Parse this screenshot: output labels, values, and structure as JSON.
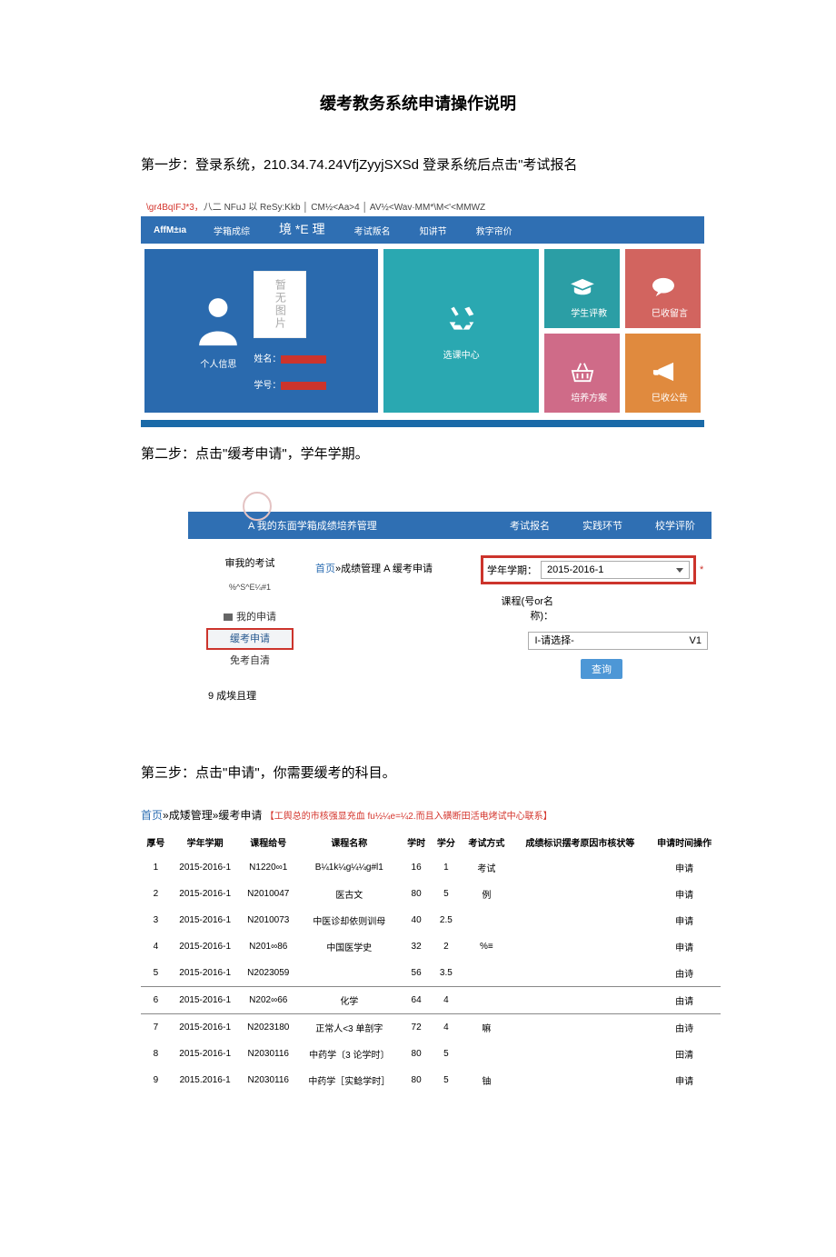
{
  "title": "缓考教务系统申请操作说明",
  "step1": "第一步：登录系统，210.34.74.24VfjZyyjSXSd 登录系统后点击\"考试报名",
  "step2": "第二步：点击\"缓考申请\"，学年学期。",
  "step3": "第三步：点击\"申请\"，你需要缓考的科目。",
  "shot1": {
    "topbar_red": "\\gr4BqIFJ*3，",
    "topbar_rest": "八二 NFuJ 以 ReSy:Kkb │ CM½<Aa>4 │ AV½<Wav·MM*\\M<'<MMWZ",
    "brand": "AffM±ıa",
    "nav": [
      "学箱成综",
      "境 *E 理",
      "考试叛名",
      "知讲节",
      "救字帘价"
    ],
    "tile_person": "个人信思",
    "noimg": "暂无图片",
    "name_lbl": "姓名：",
    "num_lbl": "学号：",
    "tile_course": "选课中心",
    "tile_eval": "学生评教",
    "tile_msg": "巳收留言",
    "tile_plan": "培养方案",
    "tile_notice": "巳收公告"
  },
  "shot2": {
    "navA": "A 我的东面学箱成绩培养管理",
    "nav": [
      "考试报名",
      "实践环节",
      "校学评阶"
    ],
    "side_hdr": "审我的考试",
    "side_sub": "%^S^E¼#1",
    "side_items": [
      "我的申请",
      "缓考申请",
      "免考自清"
    ],
    "side_foot": "9 成埃且理",
    "bread_home": "首页",
    "bread_rest": "»成绩管理 A 缓考申请",
    "f_term_lbl": "学年学期：",
    "f_term_val": "2015-2016-1",
    "f_course_lbl": "课程(号or名称)：",
    "f_course_ph": "I-请选择-",
    "f_course_v": "V1",
    "btn": "查询"
  },
  "tbl": {
    "bread_home": "首页",
    "bread_rest": "»成矮管理»缓考申请",
    "note": "【工舆总的市核强显充血 fu½¼e=¼2.而且入磺断田活电烤试中心联系】",
    "headers": [
      "厚号",
      "学年学期",
      "课程给号",
      "课程名称",
      "学时",
      "学分",
      "考试方式",
      "成绩标识摆考原因市核状等",
      "申请时间操作"
    ],
    "rows": [
      {
        "n": "1",
        "term": "2015-2016-1",
        "code": "N1220∞1",
        "name": "B¼1k¼g¼¼g#l1",
        "h": "16",
        "c": "1",
        "m": "考试",
        "s": "",
        "op": "申请"
      },
      {
        "n": "2",
        "term": "2015-2016-1",
        "code": "N2010047",
        "name": "医古文",
        "h": "80",
        "c": "5",
        "m": "例",
        "s": "",
        "op": "申请"
      },
      {
        "n": "3",
        "term": "2015-2016-1",
        "code": "N2010073",
        "name": "中医诊却依则训母",
        "h": "40",
        "c": "2.5",
        "m": "",
        "s": "",
        "op": "申请"
      },
      {
        "n": "4",
        "term": "2015-2016-1",
        "code": "N201∞86",
        "name": "中国医学史",
        "h": "32",
        "c": "2",
        "m": "%≡",
        "s": "",
        "op": "申请"
      },
      {
        "n": "5",
        "term": "2015-2016-1",
        "code": "N2023059",
        "name": "",
        "h": "56",
        "c": "3.5",
        "m": "",
        "s": "",
        "op": "由诗"
      },
      {
        "n": "6",
        "term": "2015-2016-1",
        "code": "N202∞66",
        "name": "化学",
        "h": "64",
        "c": "4",
        "m": "",
        "s": "",
        "op": "由请",
        "hl": true
      },
      {
        "n": "7",
        "term": "2015-2016-1",
        "code": "N2023180",
        "name": "正常人<3 单剖字",
        "h": "72",
        "c": "4",
        "m": "嘛",
        "s": "",
        "op": "由诗"
      },
      {
        "n": "8",
        "term": "2015-2016-1",
        "code": "N2030116",
        "name": "中药学〔3 论学时〕",
        "h": "80",
        "c": "5",
        "m": "",
        "s": "",
        "op": "田清"
      },
      {
        "n": "9",
        "term": "2015.2016-1",
        "code": "N2030116",
        "name": "中药学［实鲶学时］",
        "h": "80",
        "c": "5",
        "m": "铀",
        "s": "",
        "op": "申请"
      }
    ]
  }
}
